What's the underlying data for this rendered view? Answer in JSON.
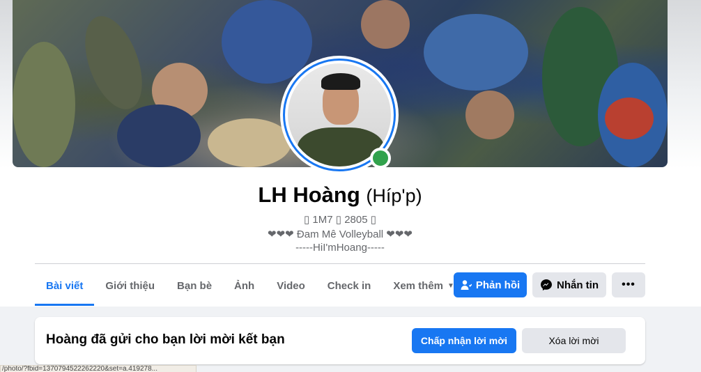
{
  "profile": {
    "name": "LH Hoàng",
    "alt_name": "(Híp'p)",
    "bio_lines": [
      "▯ 1M7 ▯ 2805 ▯",
      "❤❤❤ Đam Mê Volleyball ❤❤❤",
      "-----HiI'mHoang-----"
    ]
  },
  "tabs": [
    {
      "label": "Bài viết",
      "active": true
    },
    {
      "label": "Giới thiệu"
    },
    {
      "label": "Bạn bè"
    },
    {
      "label": "Ảnh"
    },
    {
      "label": "Video"
    },
    {
      "label": "Check in"
    },
    {
      "label": "Xem thêm"
    }
  ],
  "actions": {
    "reply_label": "Phản hồi",
    "message_label": "Nhắn tin",
    "more_label": "•••"
  },
  "friend_request": {
    "text": "Hoàng đã gửi cho bạn lời mời kết bạn",
    "accept_label": "Chấp nhận lời mời",
    "delete_label": "Xóa lời mời"
  },
  "status_bar": {
    "url": "/photo/?fbid=1370794522262220&set=a.419278..."
  },
  "colors": {
    "accent": "#1877f2",
    "online": "#31a24c",
    "secondary_button": "#e4e6eb",
    "muted_text": "#65676b",
    "feed_background": "#f0f2f5"
  },
  "icons": {
    "reply": "add-friend-icon",
    "message": "messenger-icon",
    "more": "more-dots-icon",
    "dropdown": "caret-down-icon"
  }
}
